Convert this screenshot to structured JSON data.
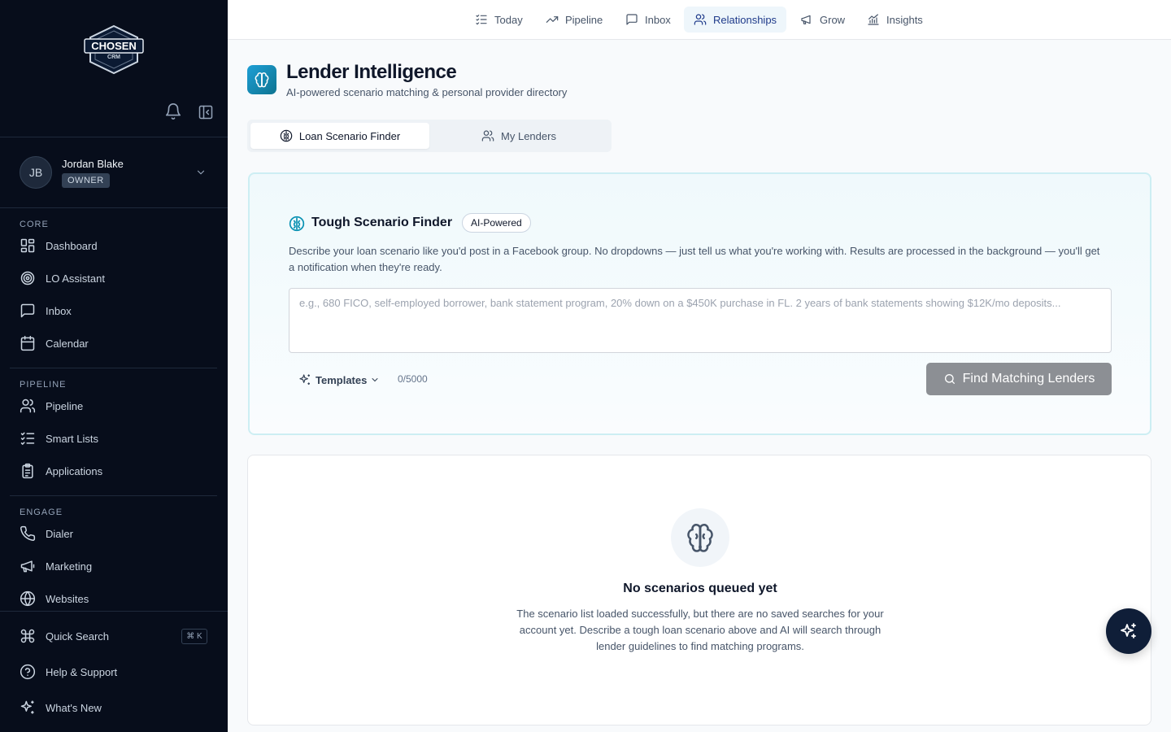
{
  "brand": {
    "logo_text": "CHOSEN",
    "logo_subtext": "CRM"
  },
  "user": {
    "initials": "JB",
    "name": "Jordan Blake",
    "role": "OWNER"
  },
  "sidebar": {
    "sections": [
      {
        "label": "CORE",
        "items": [
          {
            "label": "Dashboard",
            "icon": "grid-icon"
          },
          {
            "label": "LO Assistant",
            "icon": "target-icon"
          },
          {
            "label": "Inbox",
            "icon": "message-icon"
          },
          {
            "label": "Calendar",
            "icon": "calendar-icon"
          }
        ]
      },
      {
        "label": "PIPELINE",
        "items": [
          {
            "label": "Pipeline",
            "icon": "users-icon"
          },
          {
            "label": "Smart Lists",
            "icon": "list-check-icon"
          },
          {
            "label": "Applications",
            "icon": "clipboard-icon"
          }
        ]
      },
      {
        "label": "ENGAGE",
        "items": [
          {
            "label": "Dialer",
            "icon": "phone-icon"
          },
          {
            "label": "Marketing",
            "icon": "megaphone-icon"
          },
          {
            "label": "Websites",
            "icon": "globe-icon"
          }
        ]
      }
    ],
    "footer": [
      {
        "label": "Quick Search",
        "icon": "command-icon",
        "shortcut": "⌘ K"
      },
      {
        "label": "Help & Support",
        "icon": "help-icon"
      },
      {
        "label": "What's New",
        "icon": "sparkles-icon"
      }
    ]
  },
  "topnav": [
    {
      "label": "Today",
      "icon": "list-check-icon",
      "active": false
    },
    {
      "label": "Pipeline",
      "icon": "trending-icon",
      "active": false
    },
    {
      "label": "Inbox",
      "icon": "message-icon",
      "active": false
    },
    {
      "label": "Relationships",
      "icon": "users-icon",
      "active": true
    },
    {
      "label": "Grow",
      "icon": "megaphone-icon",
      "active": false
    },
    {
      "label": "Insights",
      "icon": "chart-icon",
      "active": false
    }
  ],
  "page": {
    "title": "Lender Intelligence",
    "subtitle": "AI-powered scenario matching & personal provider directory"
  },
  "tabs": [
    {
      "label": "Loan Scenario Finder",
      "active": true
    },
    {
      "label": "My Lenders",
      "active": false
    }
  ],
  "finder": {
    "title": "Tough Scenario Finder",
    "badge": "AI-Powered",
    "description": "Describe your loan scenario like you'd post in a Facebook group. No dropdowns — just tell us what you're working with. Results are processed in the background — you'll get a notification when they're ready.",
    "input_value": "",
    "input_placeholder": "e.g., 680 FICO, self-employed borrower, bank statement program, 20% down on a $450K purchase in FL. 2 years of bank statements showing $12K/mo deposits...",
    "templates_label": "Templates",
    "counter": "0/5000",
    "button_label": "Find Matching Lenders"
  },
  "empty_state": {
    "title": "No scenarios queued yet",
    "description": "The scenario list loaded successfully, but there are no saved searches for your account yet. Describe a tough loan scenario above and AI will search through lender guidelines to find matching programs."
  },
  "colors": {
    "sidebar_bg": "#070d1b",
    "accent": "#0891b2",
    "active_nav_bg": "#eef6fb",
    "button_disabled": "#8c8f94",
    "fab_bg": "#0f1e38"
  }
}
